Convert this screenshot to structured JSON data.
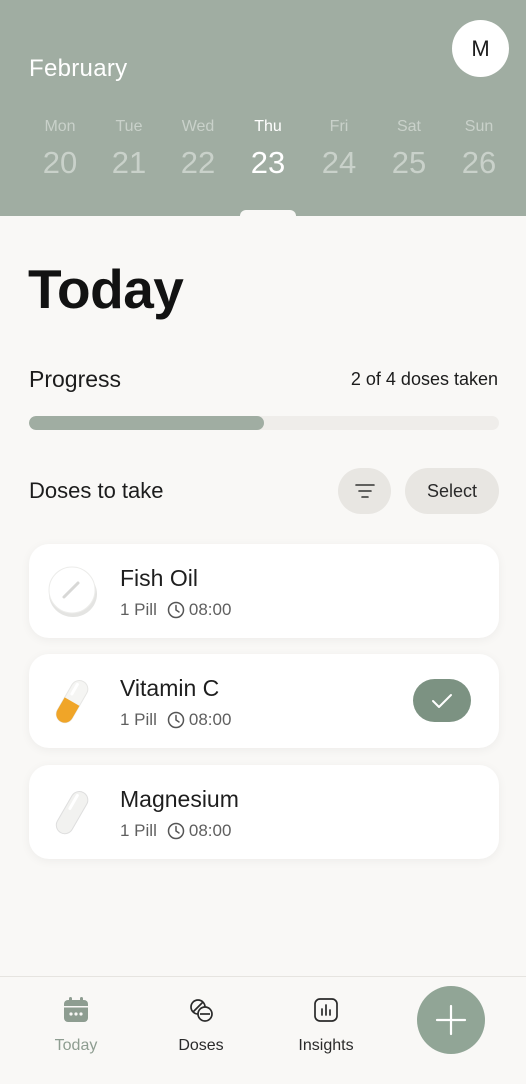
{
  "header": {
    "month": "February",
    "avatar_initial": "M",
    "days": [
      {
        "name": "Mon",
        "num": "20",
        "active": false
      },
      {
        "name": "Tue",
        "num": "21",
        "active": false
      },
      {
        "name": "Wed",
        "num": "22",
        "active": false
      },
      {
        "name": "Thu",
        "num": "23",
        "active": true
      },
      {
        "name": "Fri",
        "num": "24",
        "active": false
      },
      {
        "name": "Sat",
        "num": "25",
        "active": false
      },
      {
        "name": "Sun",
        "num": "26",
        "active": false
      }
    ]
  },
  "main": {
    "title": "Today",
    "progress": {
      "label": "Progress",
      "text": "2 of 4 doses taken",
      "taken": 2,
      "total": 4
    },
    "doses_section": {
      "title": "Doses to take",
      "filter_icon": "filter-lines-icon",
      "select_label": "Select"
    },
    "doses": [
      {
        "name": "Fish Oil",
        "amount": "1 Pill",
        "time": "08:00",
        "icon": "round-tablet-icon",
        "taken": false
      },
      {
        "name": "Vitamin C",
        "amount": "1 Pill",
        "time": "08:00",
        "icon": "capsule-orange-icon",
        "taken": true
      },
      {
        "name": "Magnesium",
        "amount": "1 Pill",
        "time": "08:00",
        "icon": "capsule-white-icon",
        "taken": false
      }
    ]
  },
  "nav": {
    "items": [
      {
        "label": "Today",
        "icon": "calendar-icon",
        "active": true
      },
      {
        "label": "Doses",
        "icon": "pills-icon",
        "active": false
      },
      {
        "label": "Insights",
        "icon": "bar-chart-icon",
        "active": false
      }
    ],
    "add_icon": "plus-icon"
  },
  "colors": {
    "header_bg": "#a0ada2",
    "accent": "#91a596",
    "check_bg": "#7c9282",
    "page_bg": "#f9f8f6"
  }
}
